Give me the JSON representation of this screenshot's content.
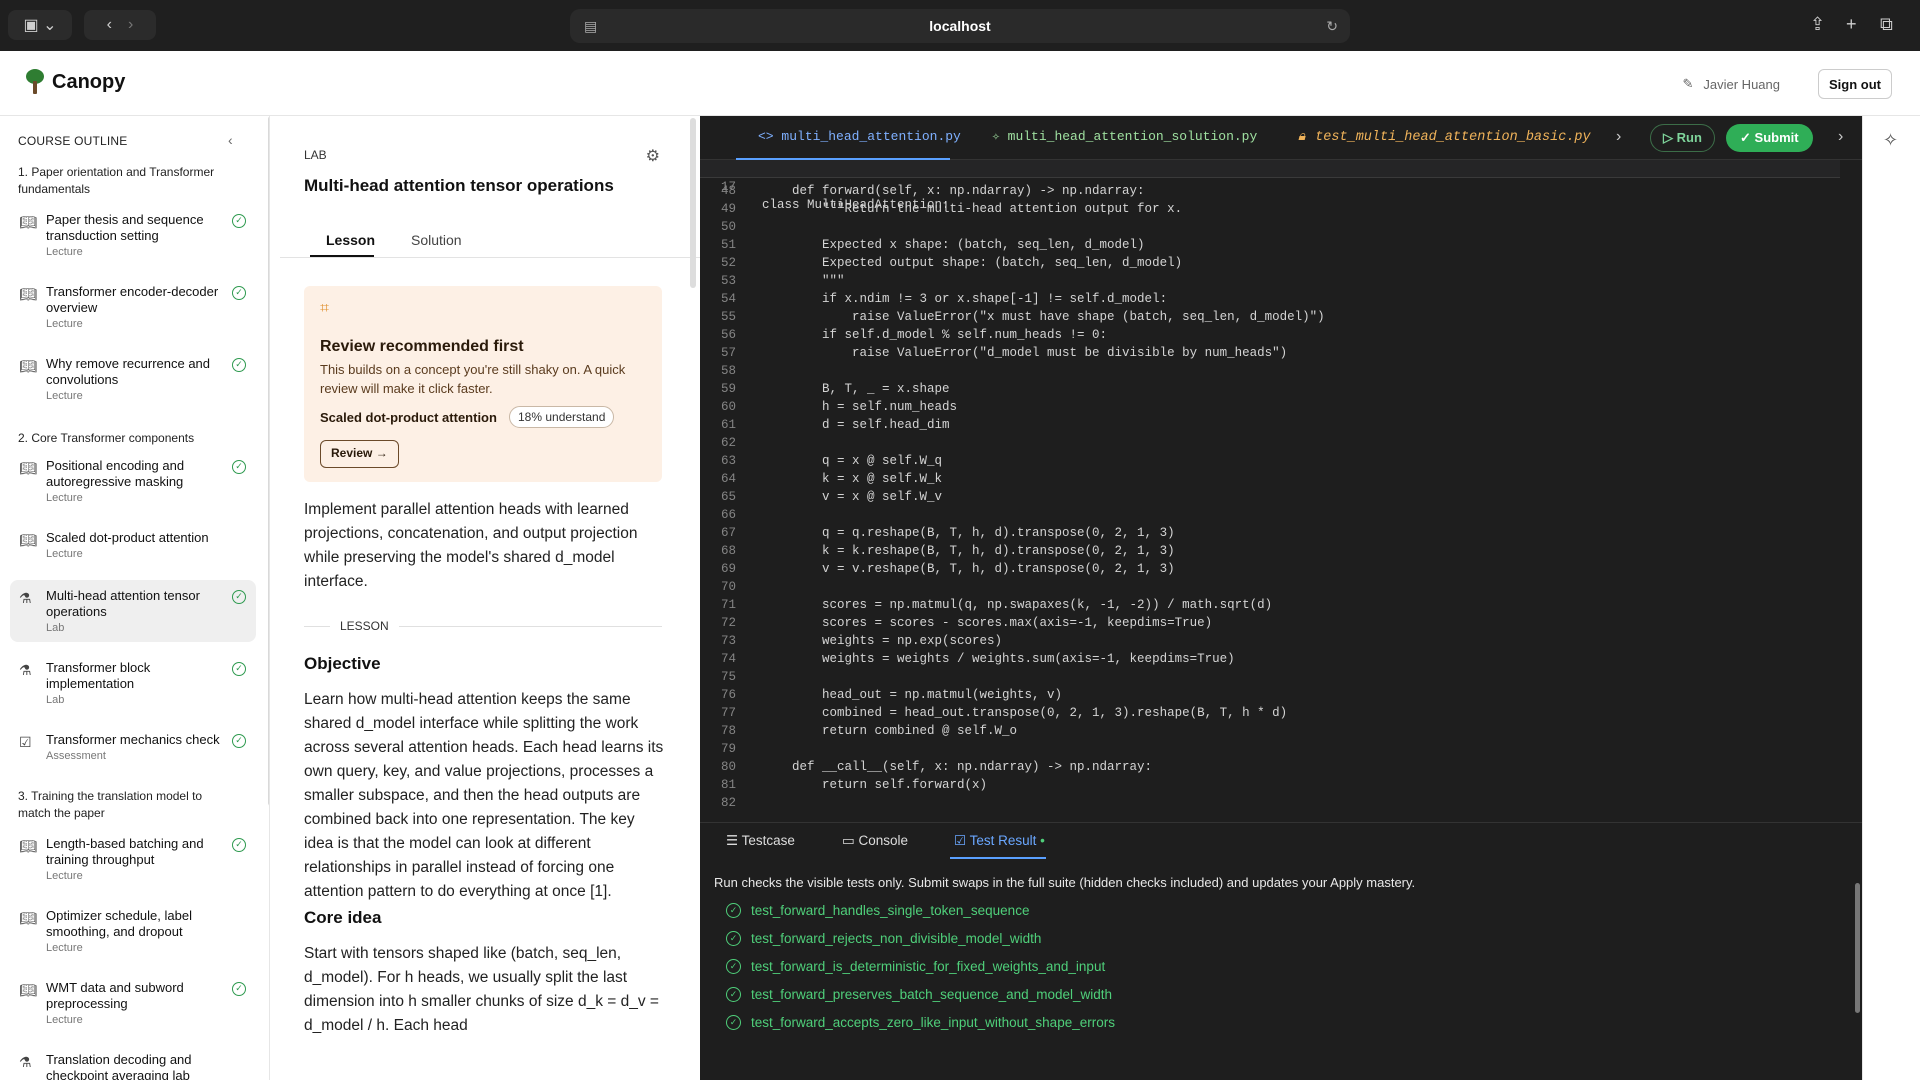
{
  "browser": {
    "address": "localhost"
  },
  "app": {
    "name": "Canopy",
    "user": "Javier Huang",
    "sign_out": "Sign out"
  },
  "sidebar": {
    "title": "COURSE OUTLINE",
    "sections": [
      {
        "label": "1. Paper orientation and Transformer fundamentals"
      },
      {
        "label": "2. Core Transformer components"
      },
      {
        "label": "3. Training the translation model to match the paper"
      }
    ],
    "items": [
      {
        "label": "Paper thesis and sequence transduction setting",
        "type": "Lecture"
      },
      {
        "label": "Transformer encoder-decoder overview",
        "type": "Lecture"
      },
      {
        "label": "Why remove recurrence and convolutions",
        "type": "Lecture"
      },
      {
        "label": "Positional encoding and autoregressive masking",
        "type": "Lecture"
      },
      {
        "label": "Scaled dot-product attention",
        "type": "Lecture"
      },
      {
        "label": "Multi-head attention tensor operations",
        "type": "Lab"
      },
      {
        "label": "Transformer block implementation",
        "type": "Lab"
      },
      {
        "label": "Transformer mechanics check",
        "type": "Assessment"
      },
      {
        "label": "Length-based batching and training throughput",
        "type": "Lecture"
      },
      {
        "label": "Optimizer schedule, label smoothing, and dropout",
        "type": "Lecture"
      },
      {
        "label": "WMT data and subword preprocessing",
        "type": "Lecture"
      },
      {
        "label": "Translation decoding and checkpoint averaging lab",
        "type": "Lab"
      }
    ]
  },
  "lesson": {
    "kind": "LAB",
    "title": "Multi-head attention tensor operations",
    "tabs": [
      "Lesson",
      "Solution"
    ],
    "review": {
      "heading": "Review recommended first",
      "body": "This builds on a concept you're still shaky on. A quick review will make it click faster.",
      "topic": "Scaled dot-product attention",
      "understand": "18% understand",
      "button": "Review"
    },
    "intro": "Implement parallel attention heads with learned projections, concatenation, and output projection while preserving the model's shared d_model interface.",
    "section_label": "LESSON",
    "objective_heading": "Objective",
    "objective": "Learn how multi-head attention keeps the same shared d_model interface while splitting the work across several attention heads. Each head learns its own query, key, and value projections, processes a smaller subspace, and then the head outputs are combined back into one representation. The key idea is that the model can look at different relationships in parallel instead of forcing one attention pattern to do everything at once [1].",
    "core_heading": "Core idea",
    "core": "Start with tensors shaped like (batch, seq_len, d_model). For h heads, we usually split the last dimension into h smaller chunks of size d_k = d_v = d_model / h. Each head"
  },
  "editor": {
    "tabs": [
      "multi_head_attention.py",
      "multi_head_attention_solution.py",
      "test_multi_head_attention_basic.py"
    ],
    "run": "Run",
    "submit": "Submit",
    "sticky": {
      "n": "17",
      "code": "class MultiHeadAttention:"
    },
    "lines": [
      {
        "n": "48",
        "code": "    def forward(self, x: np.ndarray) -> np.ndarray:"
      },
      {
        "n": "49",
        "code": "        \"\"\"Return the multi-head attention output for x."
      },
      {
        "n": "50",
        "code": ""
      },
      {
        "n": "51",
        "code": "        Expected x shape: (batch, seq_len, d_model)"
      },
      {
        "n": "52",
        "code": "        Expected output shape: (batch, seq_len, d_model)"
      },
      {
        "n": "53",
        "code": "        \"\"\""
      },
      {
        "n": "54",
        "code": "        if x.ndim != 3 or x.shape[-1] != self.d_model:"
      },
      {
        "n": "55",
        "code": "            raise ValueError(\"x must have shape (batch, seq_len, d_model)\")"
      },
      {
        "n": "56",
        "code": "        if self.d_model % self.num_heads != 0:"
      },
      {
        "n": "57",
        "code": "            raise ValueError(\"d_model must be divisible by num_heads\")"
      },
      {
        "n": "58",
        "code": ""
      },
      {
        "n": "59",
        "code": "        B, T, _ = x.shape"
      },
      {
        "n": "60",
        "code": "        h = self.num_heads"
      },
      {
        "n": "61",
        "code": "        d = self.head_dim"
      },
      {
        "n": "62",
        "code": ""
      },
      {
        "n": "63",
        "code": "        q = x @ self.W_q"
      },
      {
        "n": "64",
        "code": "        k = x @ self.W_k"
      },
      {
        "n": "65",
        "code": "        v = x @ self.W_v"
      },
      {
        "n": "66",
        "code": ""
      },
      {
        "n": "67",
        "code": "        q = q.reshape(B, T, h, d).transpose(0, 2, 1, 3)"
      },
      {
        "n": "68",
        "code": "        k = k.reshape(B, T, h, d).transpose(0, 2, 1, 3)"
      },
      {
        "n": "69",
        "code": "        v = v.reshape(B, T, h, d).transpose(0, 2, 1, 3)"
      },
      {
        "n": "70",
        "code": ""
      },
      {
        "n": "71",
        "code": "        scores = np.matmul(q, np.swapaxes(k, -1, -2)) / math.sqrt(d)"
      },
      {
        "n": "72",
        "code": "        scores = scores - scores.max(axis=-1, keepdims=True)"
      },
      {
        "n": "73",
        "code": "        weights = np.exp(scores)"
      },
      {
        "n": "74",
        "code": "        weights = weights / weights.sum(axis=-1, keepdims=True)"
      },
      {
        "n": "75",
        "code": ""
      },
      {
        "n": "76",
        "code": "        head_out = np.matmul(weights, v)"
      },
      {
        "n": "77",
        "code": "        combined = head_out.transpose(0, 2, 1, 3).reshape(B, T, h * d)"
      },
      {
        "n": "78",
        "code": "        return combined @ self.W_o"
      },
      {
        "n": "79",
        "code": ""
      },
      {
        "n": "80",
        "code": "    def __call__(self, x: np.ndarray) -> np.ndarray:"
      },
      {
        "n": "81",
        "code": "        return self.forward(x)"
      },
      {
        "n": "82",
        "code": ""
      }
    ]
  },
  "panel": {
    "tabs": [
      "Testcase",
      "Console",
      "Test Result"
    ],
    "note": "Run checks the visible tests only. Submit swaps in the full suite (hidden checks included) and updates your Apply mastery.",
    "tests": [
      "test_forward_handles_single_token_sequence",
      "test_forward_rejects_non_divisible_model_width",
      "test_forward_is_deterministic_for_fixed_weights_and_input",
      "test_forward_preserves_batch_sequence_and_model_width",
      "test_forward_accepts_zero_like_input_without_shape_errors"
    ]
  }
}
